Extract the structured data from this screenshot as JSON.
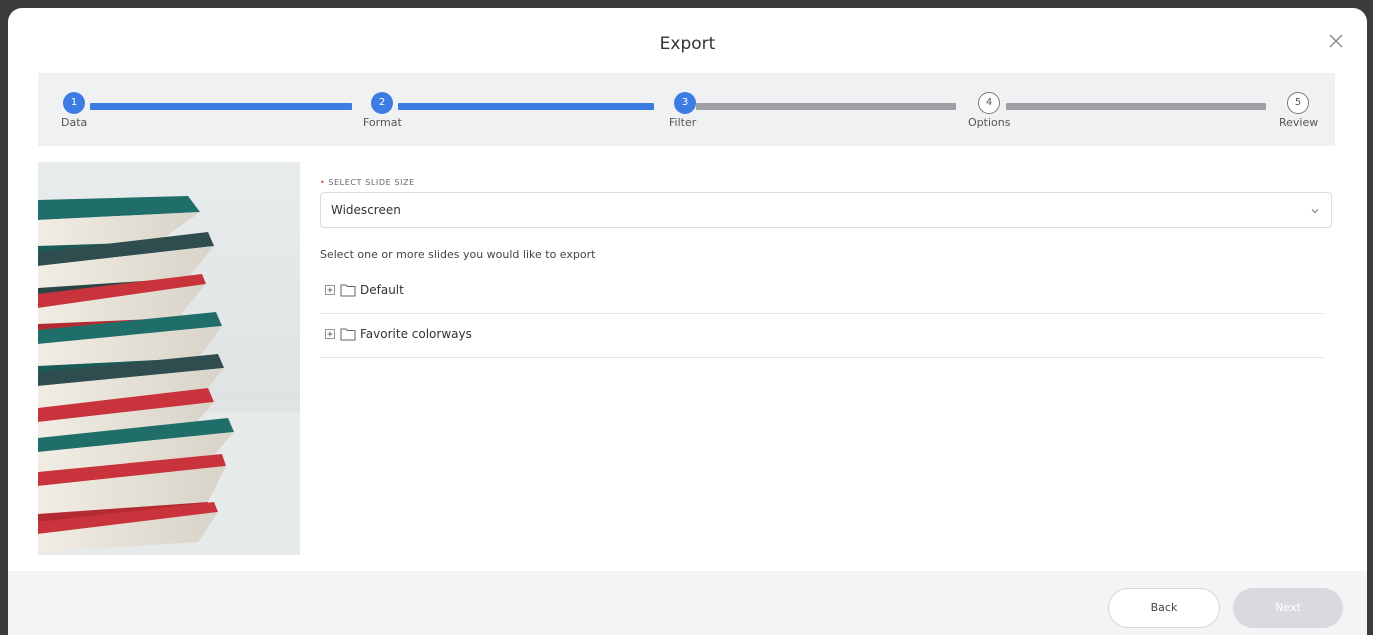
{
  "dialog": {
    "title": "Export",
    "close_icon": "close-icon"
  },
  "stepper": {
    "steps": [
      {
        "number": "1",
        "label": "Data",
        "state": "completed"
      },
      {
        "number": "2",
        "label": "Format",
        "state": "completed"
      },
      {
        "number": "3",
        "label": "Filter",
        "state": "current"
      },
      {
        "number": "4",
        "label": "Options",
        "state": "pending"
      },
      {
        "number": "5",
        "label": "Review",
        "state": "pending"
      }
    ],
    "colors": {
      "active": "#3d7de3",
      "inactive": "#9d9fa5"
    }
  },
  "form": {
    "slide_size_label": "SELECT SLIDE SIZE",
    "required_marker": "•",
    "slide_size_value": "Widescreen",
    "hint": "Select one or more slides you would like to export",
    "tree": [
      {
        "label": "Default",
        "icons": [
          "plus-square-icon",
          "folder-icon"
        ]
      },
      {
        "label": "Favorite colorways",
        "icons": [
          "plus-square-icon",
          "folder-icon"
        ]
      }
    ]
  },
  "footer": {
    "back_label": "Back",
    "next_label": "Next"
  }
}
